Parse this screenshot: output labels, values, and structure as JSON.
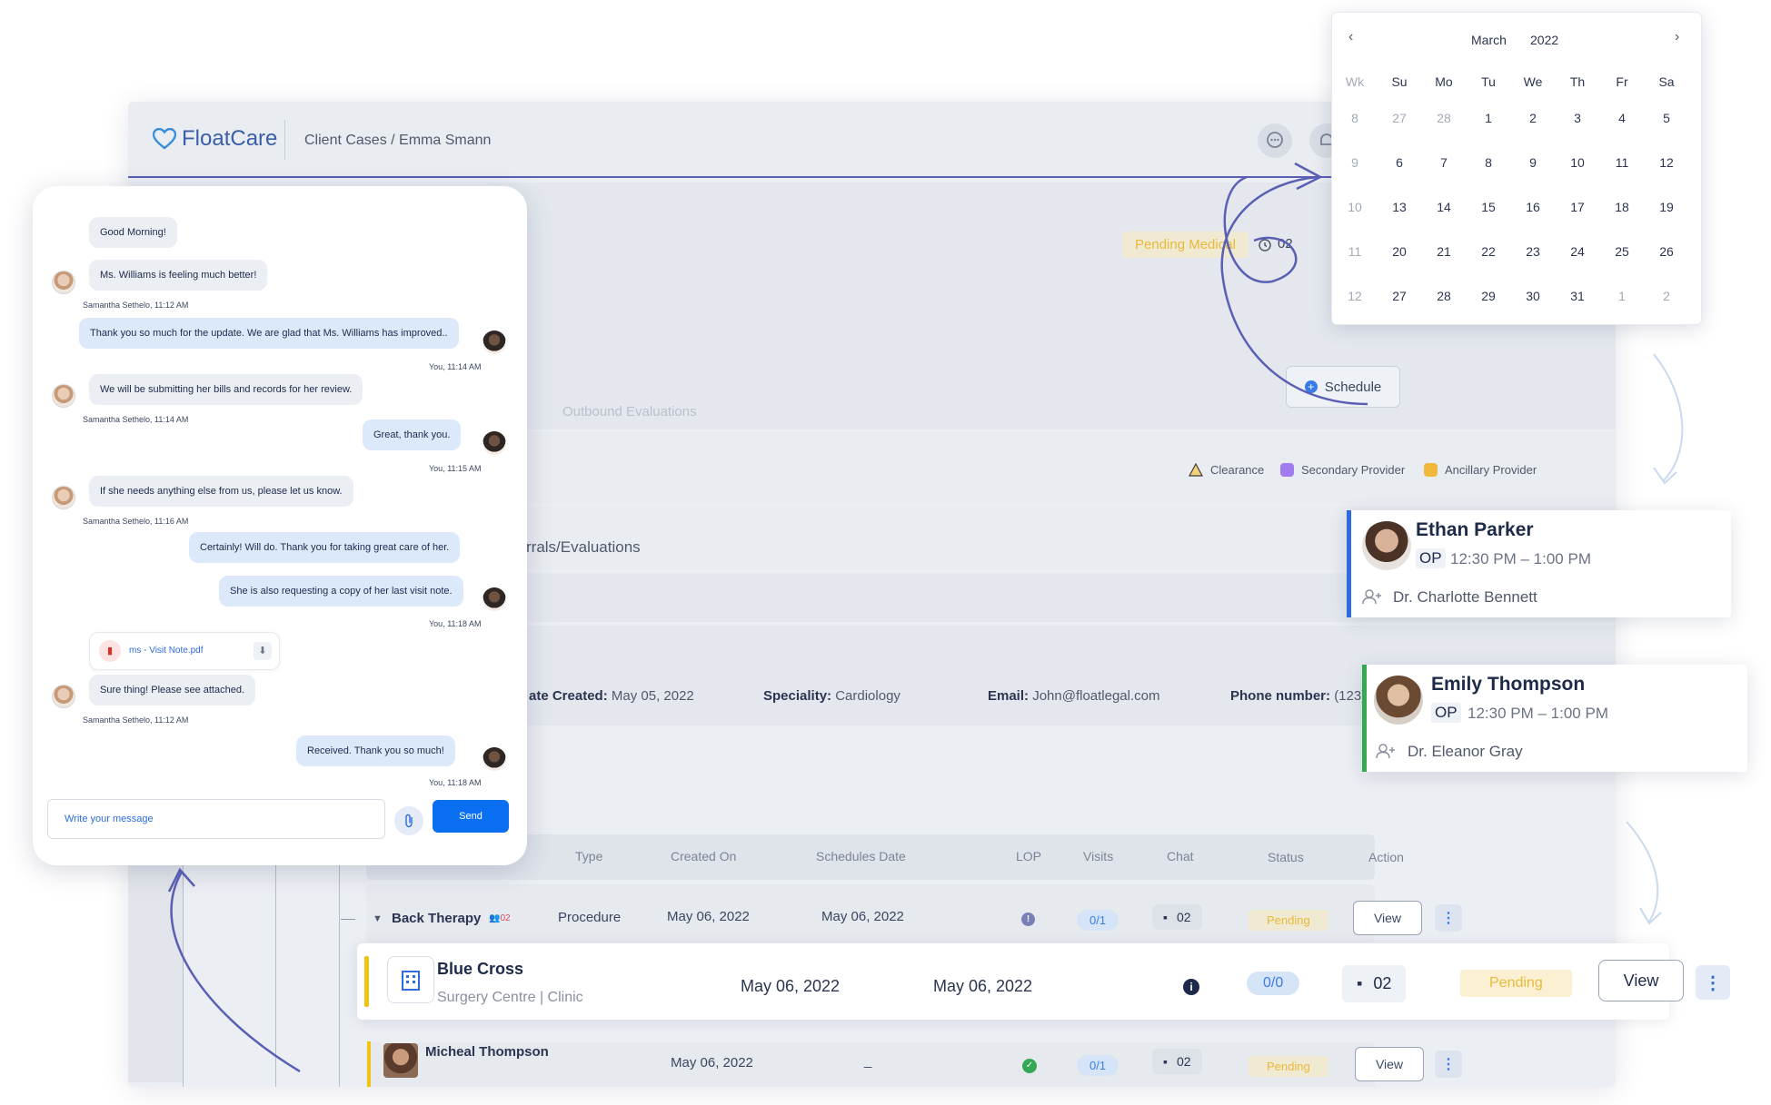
{
  "app": {
    "brand": "FloatCare",
    "breadcrumb": "Client Cases / Emma Smann",
    "status_pill": "Pending Medical",
    "case_count": "02",
    "schedule_label": "Schedule",
    "faded_tab": "Outbound Evaluations",
    "legend": [
      {
        "label": "Clearance",
        "color": "#e8b93b"
      },
      {
        "label": "Secondary Provider",
        "color": "#a17cf0"
      },
      {
        "label": "Ancillary Provider",
        "color": "#f1b93b"
      }
    ],
    "section_title": "rrals/Evaluations",
    "info": {
      "date_created_label": "ate Created:",
      "date_created_value": "May 05, 2022",
      "speciality_label": "Speciality:",
      "speciality_value": "Cardiology",
      "email_label": "Email:",
      "email_value": "John@floatlegal.com",
      "phone_label": "Phone number:",
      "phone_value": "(123)"
    }
  },
  "table": {
    "headers": [
      "Type",
      "Created On",
      "Schedules Date",
      "LOP",
      "Visits",
      "Chat",
      "Status",
      "Action"
    ],
    "rows": [
      {
        "name": "Back Therapy",
        "badge": "02",
        "type": "Procedure",
        "created": "May 06, 2022",
        "scheduled": "May 06, 2022",
        "visits": "0/1",
        "chat": "02",
        "status": "Pending",
        "action": "View"
      },
      {
        "name": "Blue Cross",
        "subtitle": "Surgery Centre | Clinic",
        "created": "May 06, 2022",
        "scheduled": "May 06, 2022",
        "visits": "0/0",
        "chat": "02",
        "status": "Pending",
        "action": "View"
      },
      {
        "name": "Micheal Thompson",
        "created": "May 06, 2022",
        "scheduled": "_",
        "visits": "0/1",
        "chat": "02",
        "status": "Pending",
        "action": "View"
      }
    ]
  },
  "chat": {
    "messages": [
      {
        "dir": "in",
        "text": "Good Morning!"
      },
      {
        "dir": "in",
        "text": "Ms. Williams is feeling much better!",
        "meta": "Samantha Sethelo, 11:12 AM"
      },
      {
        "dir": "out",
        "text": "Thank you so much for the update. We are glad that Ms. Williams has improved..",
        "meta": "You, 11:14 AM"
      },
      {
        "dir": "in",
        "text": "We will be submitting her bills and records for her review.",
        "meta": "Samantha Sethelo, 11:14 AM"
      },
      {
        "dir": "out",
        "text": "Great, thank you.",
        "meta": "You, 11:15 AM"
      },
      {
        "dir": "in",
        "text": "If she needs anything else from us, please let us know.",
        "meta": "Samantha Sethelo, 11:16 AM"
      },
      {
        "dir": "out",
        "text": "Certainly! Will do. Thank you for taking great care of her."
      },
      {
        "dir": "out",
        "text": "She is also requesting a copy of her last visit note.",
        "meta": "You, 11:18 AM"
      },
      {
        "dir": "in",
        "text": "ms - Visit Note.pdf"
      },
      {
        "dir": "in",
        "text": "Sure thing! Please see attached.",
        "meta": "Samantha Sethelo, 11:12 AM"
      },
      {
        "dir": "out",
        "text": "Received. Thank you so much!",
        "meta": "You, 11:18 AM"
      }
    ],
    "input_placeholder": "Write your message",
    "send_label": "Send"
  },
  "calendar": {
    "month": "March",
    "year": "2022",
    "headers": [
      "Wk",
      "Su",
      "Mo",
      "Tu",
      "We",
      "Th",
      "Fr",
      "Sa"
    ],
    "weeks": [
      [
        "8",
        "27",
        "28",
        "1",
        "2",
        "3",
        "4",
        "5"
      ],
      [
        "9",
        "6",
        "7",
        "8",
        "9",
        "10",
        "11",
        "12"
      ],
      [
        "10",
        "13",
        "14",
        "15",
        "16",
        "17",
        "18",
        "19"
      ],
      [
        "11",
        "20",
        "21",
        "22",
        "23",
        "24",
        "25",
        "26"
      ],
      [
        "12",
        "27",
        "28",
        "29",
        "30",
        "31",
        "1",
        "2"
      ]
    ]
  },
  "appointments": [
    {
      "name": "Ethan Parker",
      "type": "OP",
      "time": "12:30 PM – 1:00 PM",
      "doctor": "Dr. Charlotte Bennett",
      "accent": "#2d6be0"
    },
    {
      "name": "Emily Thompson",
      "type": "OP",
      "time": "12:30 PM – 1:00 PM",
      "doctor": "Dr. Eleanor Gray",
      "accent": "#34a853"
    }
  ]
}
